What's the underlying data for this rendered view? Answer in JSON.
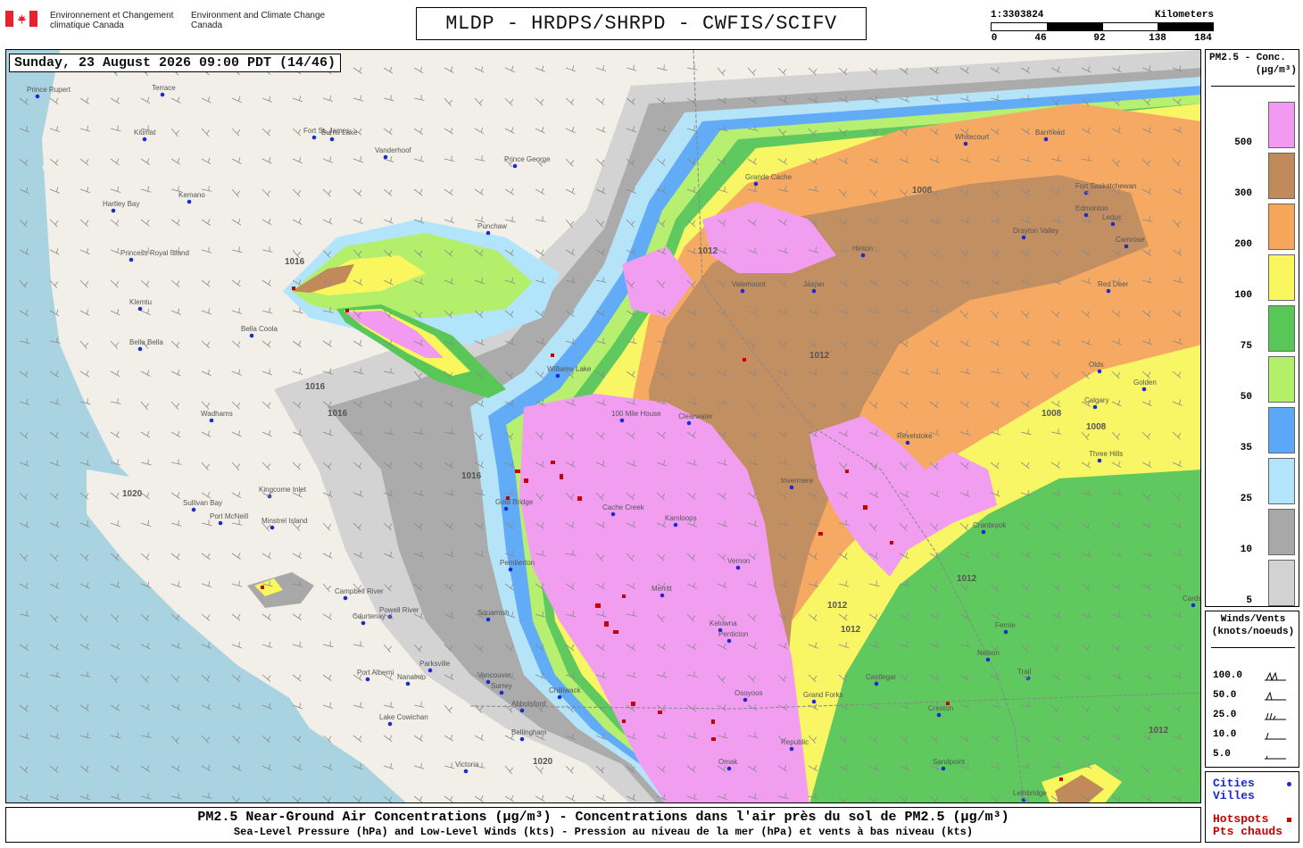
{
  "header": {
    "department_fr": "Environnement et Changement climatique Canada",
    "department_en": "Environment and Climate Change Canada",
    "title": "MLDP - HRDPS/SHRPD - CWFIS/SCIFV",
    "scale_ratio": "1:3303824",
    "scale_unit": "Kilometers",
    "scale_ticks": [
      "0",
      "46",
      "92",
      "138",
      "184"
    ]
  },
  "map": {
    "timestamp": "Sunday, 23 August 2026 09:00 PDT (14/46)",
    "places": [
      "Prince Rupert",
      "Terrace",
      "Kitimat",
      "Fort St. James",
      "Vanderhoof",
      "Prince George",
      "Kemano",
      "Burns Lake",
      "Hartley Bay",
      "Princess Royal Island",
      "Klemtu",
      "Bella Bella",
      "Bella Coola",
      "Punchaw",
      "Williams Lake",
      "100 Mile House",
      "Clearwater",
      "Wadhams",
      "Sullivan Bay",
      "Kingcome Inlet",
      "Port McNeill",
      "Minstrel Island",
      "Campbell River",
      "Courtenay",
      "Powell River",
      "Port Alberni",
      "Parksville",
      "Nanaimo",
      "Lake Cowichan",
      "Victoria",
      "Vancouver",
      "Surrey",
      "Chilliwack",
      "Abbotsford",
      "Bellingham",
      "Squamish",
      "Pemberton",
      "Gold Bridge",
      "Cache Creek",
      "Kamloops",
      "Merritt",
      "Kelowna",
      "Vernon",
      "Penticton",
      "Osoyoos",
      "Grand Forks",
      "Republic",
      "Omak",
      "Valemount",
      "Jasper",
      "Hinton",
      "Grande Cache",
      "Whitecourt",
      "Barrhead",
      "Fort Saskatchewan",
      "Edmonton",
      "Leduc",
      "Drayton Valley",
      "Camrose",
      "Red Deer",
      "Olds",
      "Calgary",
      "Three Hills",
      "Golden",
      "Revelstoke",
      "Invermere",
      "Cranbrook",
      "Fernie",
      "Nelson",
      "Trail",
      "Castlegar",
      "Creston",
      "Sandpoint",
      "Lethbridge",
      "Cardston"
    ],
    "isobars": [
      "1016",
      "1012",
      "1016",
      "1016",
      "1012",
      "1020",
      "1008",
      "1012",
      "1008",
      "1012",
      "1012",
      "1008",
      "1012",
      "1016",
      "1020"
    ]
  },
  "legend": {
    "title_line1": "PM2.5 - Conc.",
    "title_line2": "(µg/m³)",
    "bins": [
      {
        "label": "500",
        "color": "#f29af2"
      },
      {
        "label": "300",
        "color": "#c08a5b"
      },
      {
        "label": "200",
        "color": "#f6a65b"
      },
      {
        "label": "100",
        "color": "#f9f75d"
      },
      {
        "label": "75",
        "color": "#58c758"
      },
      {
        "label": "50",
        "color": "#b4ef6b"
      },
      {
        "label": "35",
        "color": "#5ba8f8"
      },
      {
        "label": "25",
        "color": "#b2e4fb"
      },
      {
        "label": "10",
        "color": "#a8a8a8"
      },
      {
        "label": "5",
        "color": "#d2d2d2"
      }
    ]
  },
  "winds": {
    "title_line1": "Winds/Vents",
    "title_line2": "(knots/noeuds)",
    "rows": [
      "100.0",
      "50.0",
      "25.0",
      "10.0",
      "5.0"
    ]
  },
  "markers": {
    "cities_en": "Cities",
    "cities_fr": "Villes",
    "hotspots_en": "Hotspots",
    "hotspots_fr": "Pts chauds"
  },
  "caption": {
    "line1": "PM2.5 Near-Ground Air Concentrations (µg/m³) - Concentrations dans l'air près du sol de PM2.5 (µg/m³)",
    "line2": "Sea-Level Pressure (hPa) and Low-Level Winds (kts) - Pression au niveau de la mer (hPa) et vents à bas niveau (kts)"
  },
  "colors": {
    "ocean": "#a9d3e0",
    "land": "#f1efe7",
    "hotspot": "#c40000",
    "city": "#1a2bd0"
  }
}
